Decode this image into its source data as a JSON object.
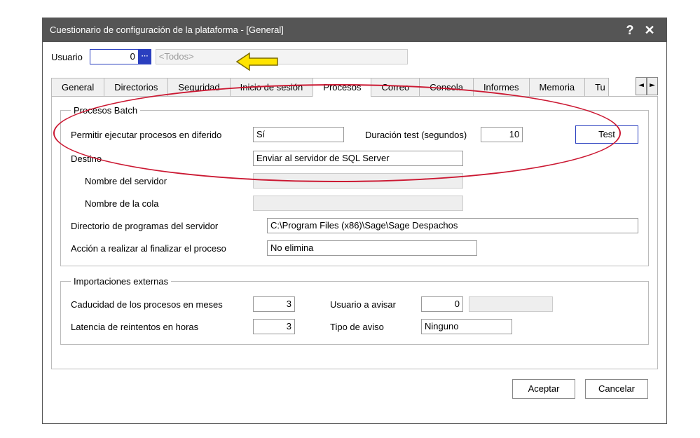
{
  "title": "Cuestionario de configuración de la plataforma - [General]",
  "user": {
    "label": "Usuario",
    "value": "0",
    "placeholder": "<Todos>"
  },
  "tabs": {
    "items": [
      "General",
      "Directorios",
      "Seguridad",
      "Inicio de sesión",
      "Procesos",
      "Correo",
      "Consola",
      "Informes",
      "Memoria",
      "Tu"
    ],
    "active_index": 4
  },
  "batch": {
    "legend": "Procesos Batch",
    "permit_label": "Permitir ejecutar procesos en diferido",
    "permit_value": "Sí",
    "duration_label": "Duración test (segundos)",
    "duration_value": "10",
    "test_button": "Test",
    "dest_label": "Destino",
    "dest_value": "Enviar al servidor de SQL Server",
    "server_name_label": "Nombre del servidor",
    "server_name_value": "",
    "queue_name_label": "Nombre de la cola",
    "queue_name_value": "",
    "progdir_label": "Directorio de programas del servidor",
    "progdir_value": "C:\\Program Files (x86)\\Sage\\Sage Despachos",
    "finish_action_label": "Acción a realizar al finalizar el proceso",
    "finish_action_value": "No elimina"
  },
  "ext": {
    "legend": "Importaciones externas",
    "expiry_label": "Caducidad de los procesos en meses",
    "expiry_value": "3",
    "notify_user_label": "Usuario a avisar",
    "notify_user_value": "0",
    "latency_label": "Latencia de reintentos en horas",
    "latency_value": "3",
    "alert_type_label": "Tipo de aviso",
    "alert_type_value": "Ninguno"
  },
  "buttons": {
    "ok": "Aceptar",
    "cancel": "Cancelar"
  }
}
